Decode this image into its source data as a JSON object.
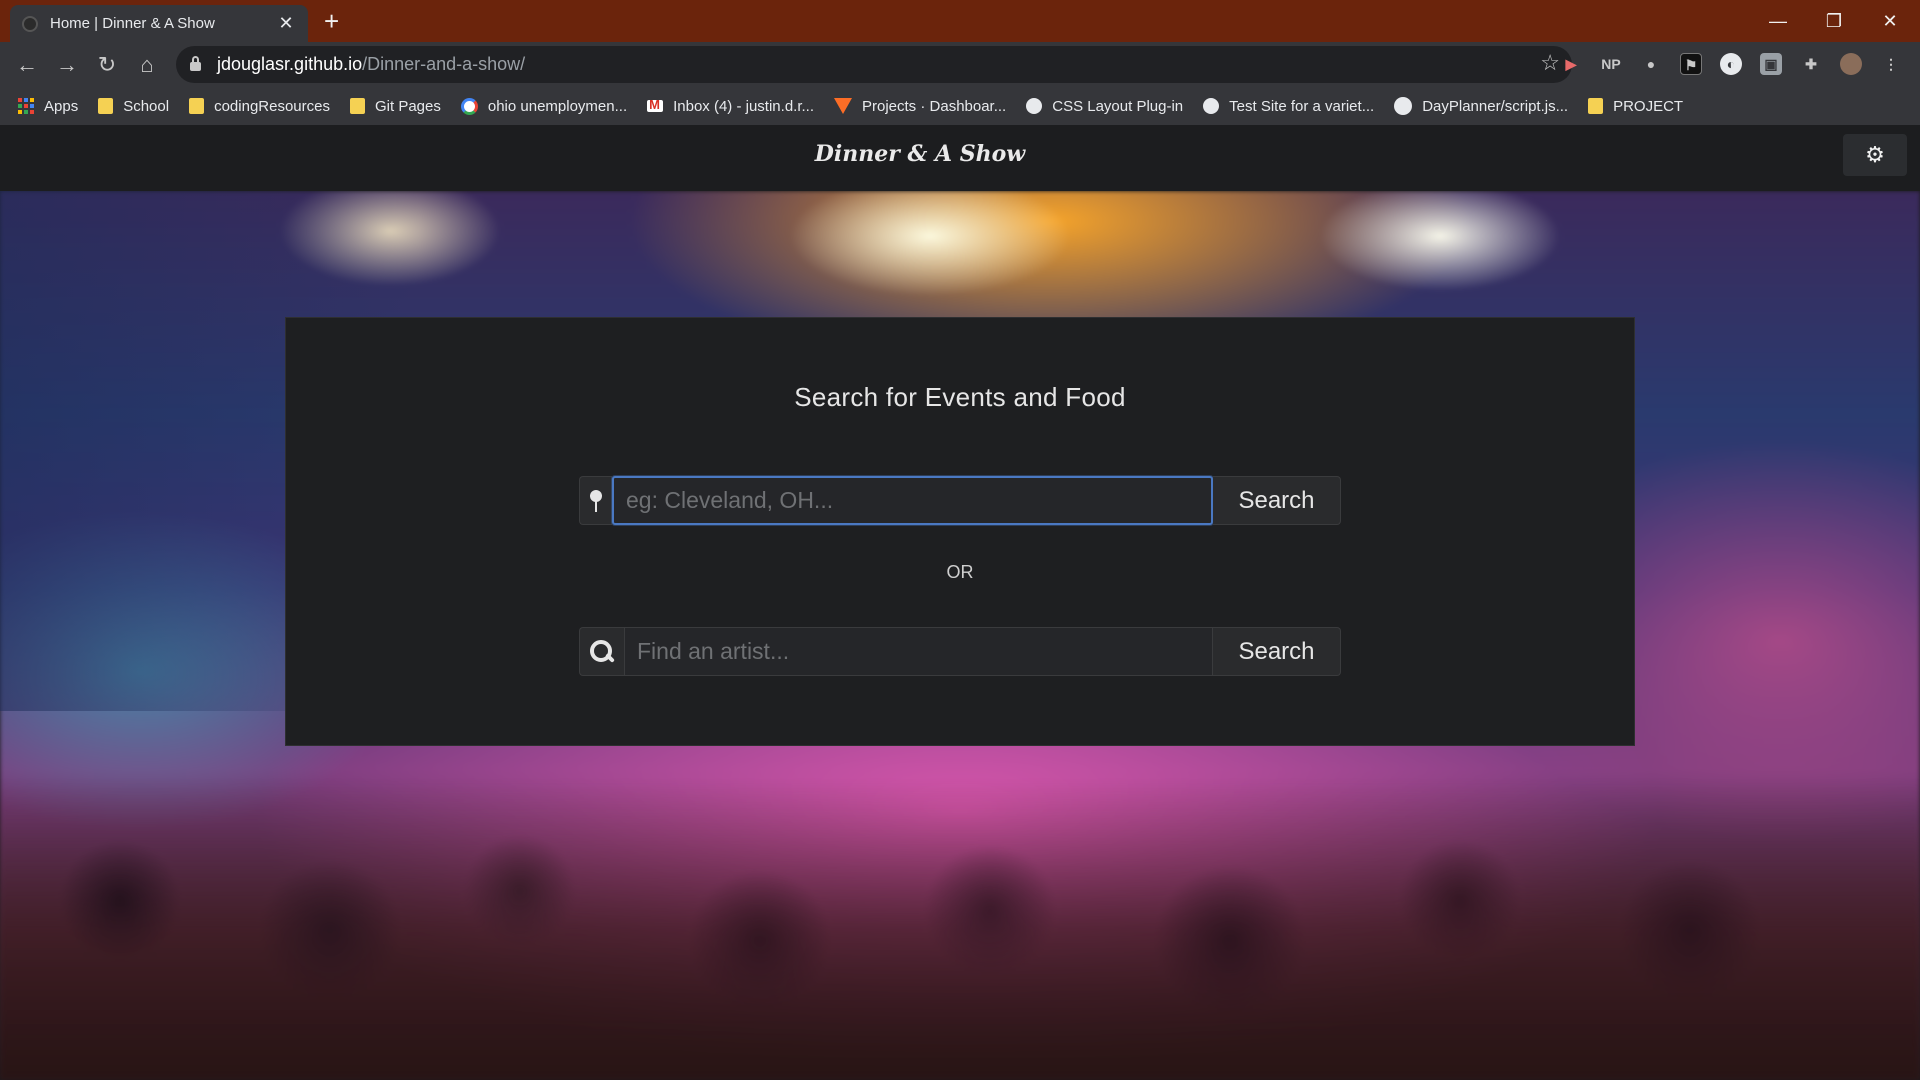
{
  "browser": {
    "tab_title": "Home | Dinner & A Show",
    "url_host": "jdouglasr.github.io",
    "url_path": "/Dinner-and-a-show/",
    "extensions": [
      "NP"
    ],
    "bookmarks": [
      {
        "label": "Apps",
        "icon": "apps-icon"
      },
      {
        "label": "School",
        "icon": "folder-icon"
      },
      {
        "label": "codingResources",
        "icon": "folder-icon"
      },
      {
        "label": "Git Pages",
        "icon": "folder-icon"
      },
      {
        "label": "ohio unemploymen...",
        "icon": "google-icon"
      },
      {
        "label": "Inbox (4) - justin.d.r...",
        "icon": "gmail-icon"
      },
      {
        "label": "Projects · Dashboar...",
        "icon": "gitlab-icon"
      },
      {
        "label": "CSS Layout Plug-in",
        "icon": "globe-icon"
      },
      {
        "label": "Test Site for a variet...",
        "icon": "globe-icon"
      },
      {
        "label": "DayPlanner/script.js...",
        "icon": "github-icon"
      },
      {
        "label": "PROJECT",
        "icon": "folder-icon"
      }
    ]
  },
  "site": {
    "brand": "Dinner & A Show"
  },
  "search": {
    "title": "Search for Events and Food",
    "location_placeholder": "eg: Cleveland, OH...",
    "location_button": "Search",
    "or_label": "OR",
    "artist_placeholder": "Find an artist...",
    "artist_button": "Search"
  },
  "colors": {
    "tabbar": "#6b240c",
    "chrome": "#35363a",
    "panel": "#1e1f21",
    "focus_ring": "#4a78c2"
  }
}
